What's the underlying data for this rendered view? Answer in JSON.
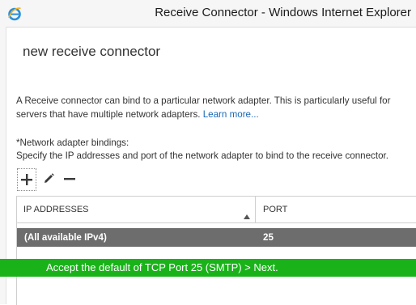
{
  "window": {
    "title": "Receive Connector - Windows Internet Explorer",
    "icon": "internet-explorer-icon"
  },
  "page": {
    "title": "new receive connector",
    "description": "A Receive connector can bind to a particular network adapter. This is particularly useful for servers that have multiple network adapters.",
    "learn_more": "Learn more..."
  },
  "bindings": {
    "label": "*Network adapter bindings:",
    "help": "Specify the IP addresses and port of the network adapter to bind to the receive connector.",
    "toolbar": {
      "add_icon": "plus-icon",
      "edit_icon": "pencil-icon",
      "remove_icon": "minus-icon"
    },
    "columns": {
      "ip": "IP ADDRESSES",
      "port": "PORT"
    },
    "rows": [
      {
        "ip": "(All available IPv4)",
        "port": "25",
        "selected": true
      }
    ]
  },
  "annotation": {
    "text": "Accept the default of TCP Port 25 (SMTP) > Next.",
    "color": "#19b319"
  },
  "colors": {
    "link": "#1a69b5",
    "selected_row": "#6d6d6d"
  }
}
